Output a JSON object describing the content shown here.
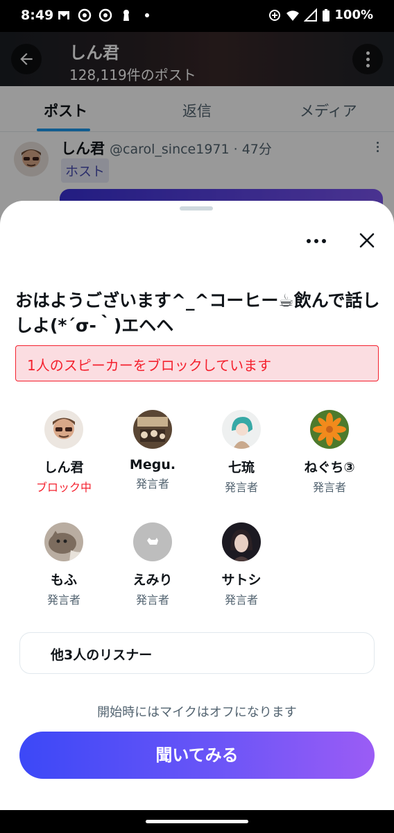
{
  "status_bar": {
    "time": "8:49",
    "battery": "100%",
    "icons": [
      "gmail-icon",
      "chrome-icon",
      "chrome-icon",
      "keyhole-icon",
      "dot-icon",
      "data-saver-icon",
      "wifi-icon",
      "signal-icon",
      "battery-icon"
    ]
  },
  "header": {
    "title": "しん君",
    "subtitle": "128,119件のポスト"
  },
  "tabs": [
    {
      "label": "ポスト",
      "active": true
    },
    {
      "label": "返信",
      "active": false
    },
    {
      "label": "メディア",
      "active": false
    }
  ],
  "post": {
    "name": "しん君",
    "handle": "@carol_since1971 · 47分",
    "badge": "ホスト"
  },
  "sheet": {
    "title": "おはようございます^_^コーヒー☕飲んで話ししよ(*´σ-｀)エヘヘ",
    "block_notice": "1人のスピーカーをブロックしています",
    "participants": [
      {
        "name": "しん君",
        "role": "ブロック中",
        "blocked": true
      },
      {
        "name": "Megu.",
        "role": "発言者",
        "blocked": false
      },
      {
        "name": "七琉",
        "role": "発言者",
        "blocked": false
      },
      {
        "name": "ねぐち③",
        "role": "発言者",
        "blocked": false
      },
      {
        "name": "もふ",
        "role": "発言者",
        "blocked": false
      },
      {
        "name": "えみり",
        "role": "発言者",
        "blocked": false
      },
      {
        "name": "サトシ",
        "role": "発言者",
        "blocked": false
      }
    ],
    "listeners": "他3人のリスナー",
    "mic_note": "開始時にはマイクはオフになります",
    "listen_button": "聞いてみる"
  },
  "colors": {
    "accent_blue": "#1d9bf0",
    "block_red": "#f4212e",
    "button_gradient_start": "#3c48f7",
    "button_gradient_end": "#9b5cf5"
  }
}
